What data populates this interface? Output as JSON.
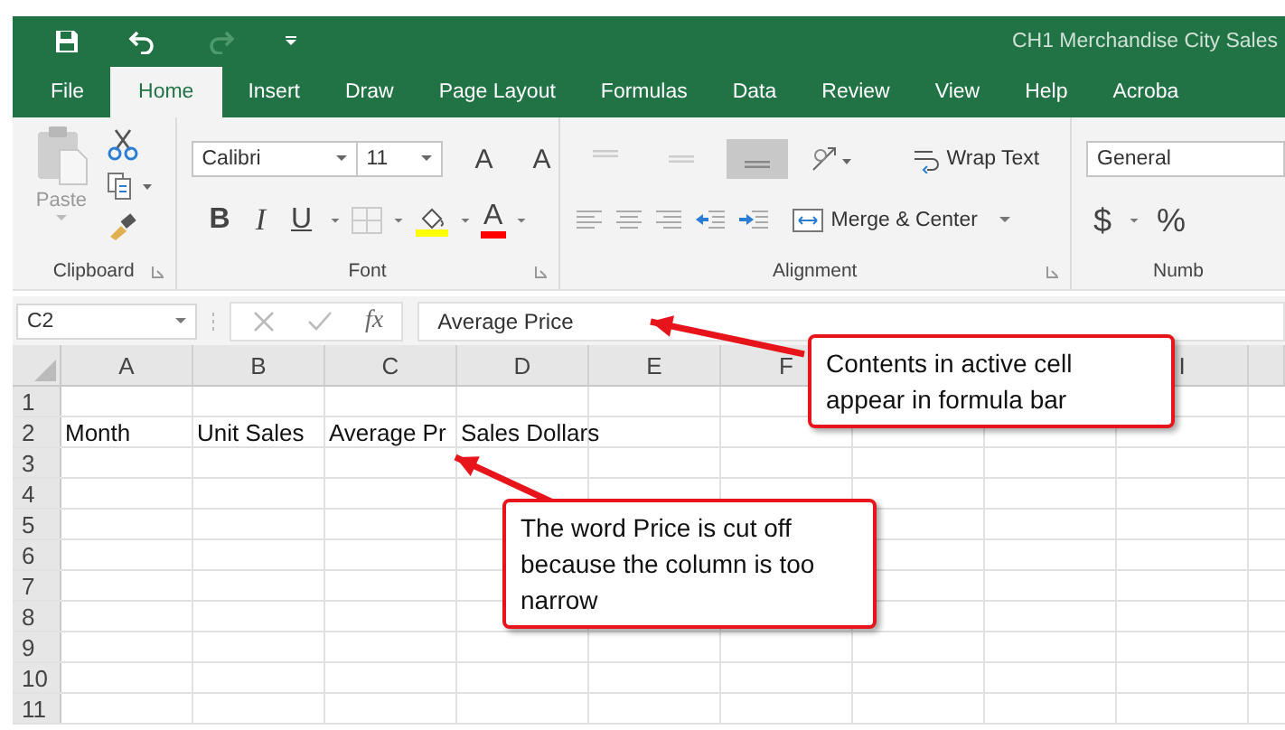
{
  "window": {
    "title": "CH1 Merchandise City Sales"
  },
  "quick_access": [
    {
      "kind": "save",
      "disabled": false
    },
    {
      "kind": "undo",
      "disabled": false
    },
    {
      "kind": "redo",
      "disabled": true
    },
    {
      "kind": "customize",
      "disabled": false
    }
  ],
  "tabs": [
    {
      "label": "File",
      "selected": false
    },
    {
      "label": "Home",
      "selected": true
    },
    {
      "label": "Insert",
      "selected": false
    },
    {
      "label": "Draw",
      "selected": false
    },
    {
      "label": "Page Layout",
      "selected": false
    },
    {
      "label": "Formulas",
      "selected": false
    },
    {
      "label": "Data",
      "selected": false
    },
    {
      "label": "Review",
      "selected": false
    },
    {
      "label": "View",
      "selected": false
    },
    {
      "label": "Help",
      "selected": false
    },
    {
      "label": "Acroba",
      "selected": false
    }
  ],
  "ribbon": {
    "clipboard": {
      "label": "Clipboard",
      "paste": "Paste",
      "paste_disabled": true
    },
    "font": {
      "label": "Font",
      "name": "Calibri",
      "size": "11",
      "grow": "A",
      "shrink": "A",
      "bold": "B",
      "italic": "I",
      "underline": "U",
      "font_color_label": "A"
    },
    "alignment": {
      "label": "Alignment",
      "vertical": [
        {
          "kind": "top",
          "selected": false
        },
        {
          "kind": "middle",
          "selected": false
        },
        {
          "kind": "bottom",
          "selected": true
        }
      ],
      "wrap_text": "Wrap Text",
      "merge_center": "Merge & Center"
    },
    "number": {
      "label": "Numb",
      "format": "General",
      "currency": "$",
      "percent": "%"
    }
  },
  "formula_bar": {
    "name_box": "C2",
    "fx": "fx",
    "value": "Average Price"
  },
  "sheet": {
    "columns": [
      {
        "label": "A"
      },
      {
        "label": "B"
      },
      {
        "label": "C"
      },
      {
        "label": "D"
      },
      {
        "label": "E"
      },
      {
        "label": "F"
      },
      {
        "label": "I"
      }
    ],
    "rows": [
      {
        "header": "1",
        "cells": []
      },
      {
        "header": "2",
        "cells": [
          "Month",
          "Unit Sales",
          "Average Pr",
          "Sales Dollars"
        ]
      },
      {
        "header": "3",
        "cells": []
      },
      {
        "header": "4",
        "cells": []
      },
      {
        "header": "5",
        "cells": []
      },
      {
        "header": "6",
        "cells": []
      },
      {
        "header": "7",
        "cells": []
      },
      {
        "header": "8",
        "cells": []
      },
      {
        "header": "9",
        "cells": []
      },
      {
        "header": "10",
        "cells": []
      },
      {
        "header": "11",
        "cells": []
      }
    ]
  },
  "callouts": [
    {
      "text": "Contents in active cell appear in formula bar",
      "kind": "formula"
    },
    {
      "text": "The word Price is cut off because the column is too narrow",
      "kind": "cell"
    }
  ]
}
